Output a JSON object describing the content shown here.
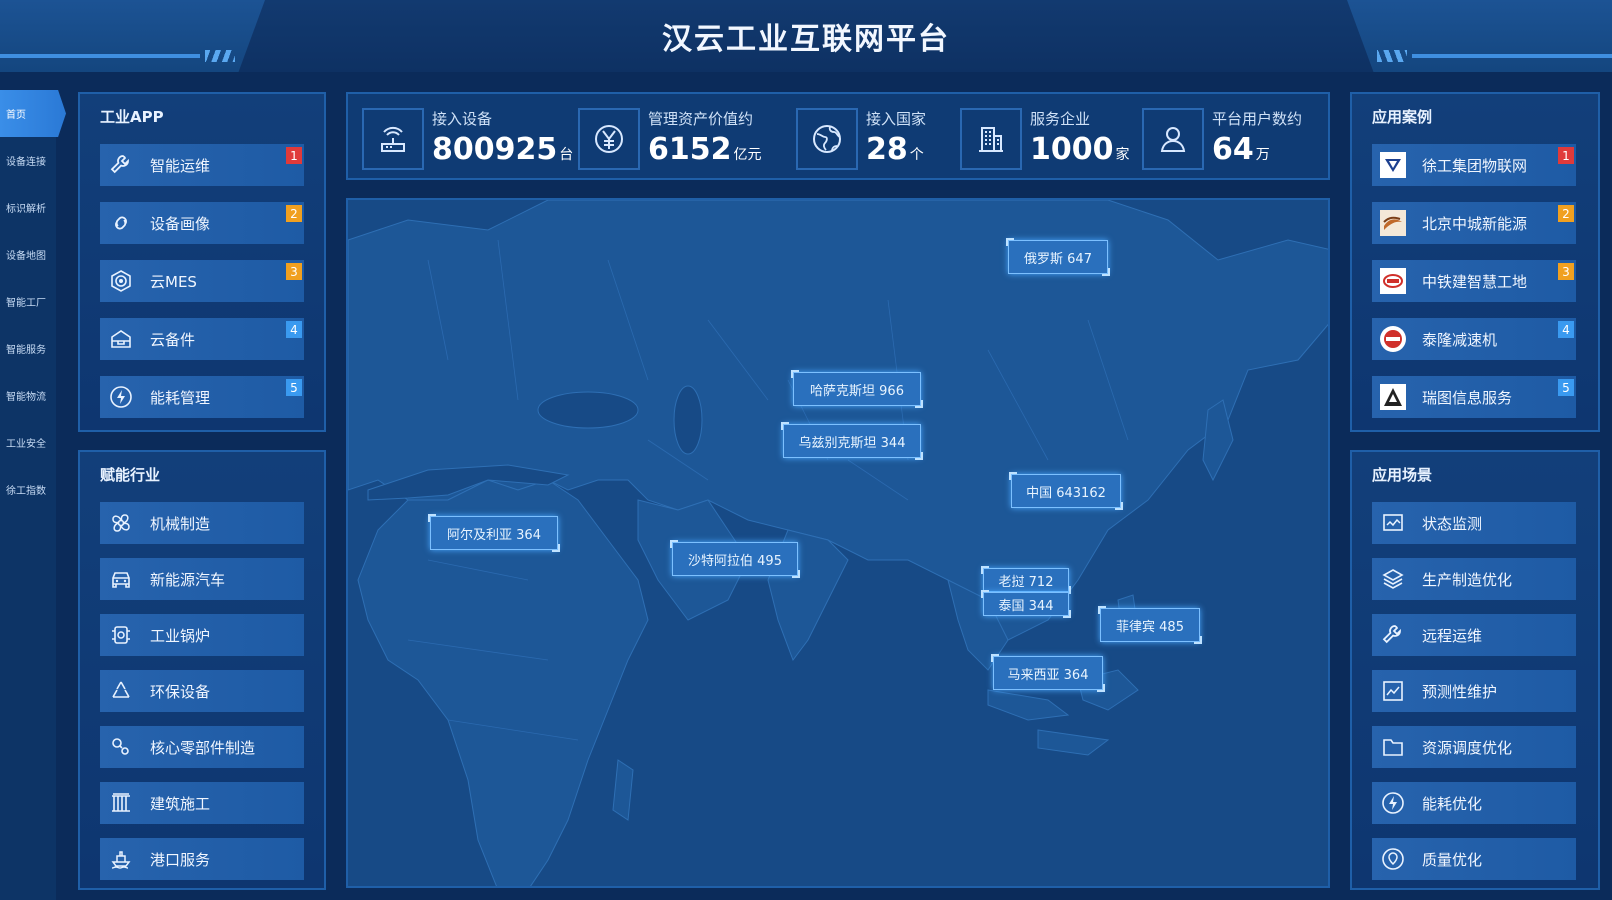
{
  "header": {
    "title": "汉云工业互联网平台"
  },
  "leftnav": {
    "items": [
      {
        "label": "首页",
        "active": true
      },
      {
        "label": "设备连接",
        "active": false
      },
      {
        "label": "标识解析",
        "active": false
      },
      {
        "label": "设备地图",
        "active": false
      },
      {
        "label": "智能工厂",
        "active": false
      },
      {
        "label": "智能服务",
        "active": false
      },
      {
        "label": "智能物流",
        "active": false
      },
      {
        "label": "工业安全",
        "active": false
      },
      {
        "label": "徐工指数",
        "active": false
      }
    ]
  },
  "industrial_app": {
    "title": "工业APP",
    "items": [
      {
        "label": "智能运维",
        "badge": "1",
        "badge_color": "#e03a3a",
        "icon": "wrench-icon"
      },
      {
        "label": "设备画像",
        "badge": "2",
        "badge_color": "#f0a020",
        "icon": "link-icon"
      },
      {
        "label": "云MES",
        "badge": "3",
        "badge_color": "#f0a020",
        "icon": "target-icon"
      },
      {
        "label": "云备件",
        "badge": "4",
        "badge_color": "#3a9af0",
        "icon": "box-icon"
      },
      {
        "label": "能耗管理",
        "badge": "5",
        "badge_color": "#3a9af0",
        "icon": "lightning-icon"
      }
    ]
  },
  "industries": {
    "title": "赋能行业",
    "items": [
      {
        "label": "机械制造",
        "icon": "fan-icon"
      },
      {
        "label": "新能源汽车",
        "icon": "car-icon"
      },
      {
        "label": "工业锅炉",
        "icon": "boiler-icon"
      },
      {
        "label": "环保设备",
        "icon": "recycle-icon"
      },
      {
        "label": "核心零部件制造",
        "icon": "gears-icon"
      },
      {
        "label": "建筑施工",
        "icon": "building-icon"
      },
      {
        "label": "港口服务",
        "icon": "ship-icon"
      }
    ]
  },
  "stats": [
    {
      "label": "接入设备",
      "value": "800925",
      "unit": "台",
      "icon": "router-icon"
    },
    {
      "label": "管理资产价值约",
      "value": "6152",
      "unit": "亿元",
      "icon": "yuan-icon"
    },
    {
      "label": "接入国家",
      "value": "28",
      "unit": "个",
      "icon": "globe-icon"
    },
    {
      "label": "服务企业",
      "value": "1000",
      "unit": "家",
      "icon": "office-icon"
    },
    {
      "label": "平台用户数约",
      "value": "64",
      "unit": "万",
      "icon": "user-icon"
    }
  ],
  "map_tags": [
    {
      "text": "俄罗斯 647"
    },
    {
      "text": "哈萨克斯坦 966"
    },
    {
      "text": "乌兹别克斯坦 344"
    },
    {
      "text": "中国 643162"
    },
    {
      "text": "阿尔及利亚 364"
    },
    {
      "text": "沙特阿拉伯 495"
    },
    {
      "text": "老挝 712"
    },
    {
      "text": "泰国 344"
    },
    {
      "text": "菲律宾 485"
    },
    {
      "text": "马来西亚 364"
    }
  ],
  "cases": {
    "title": "应用案例",
    "items": [
      {
        "label": "徐工集团物联网",
        "badge": "1",
        "badge_color": "#e03a3a",
        "logo": "xcmg-logo-icon"
      },
      {
        "label": "北京中城新能源",
        "badge": "2",
        "badge_color": "#f0a020",
        "logo": "energy-logo-icon"
      },
      {
        "label": "中铁建智慧工地",
        "badge": "3",
        "badge_color": "#f0a020",
        "logo": "crcc-logo-icon"
      },
      {
        "label": "泰隆减速机",
        "badge": "4",
        "badge_color": "#3a9af0",
        "logo": "tailong-logo-icon"
      },
      {
        "label": "瑞图信息服务",
        "badge": "5",
        "badge_color": "#3a9af0",
        "logo": "ruitu-logo-icon"
      }
    ]
  },
  "scenes": {
    "title": "应用场景",
    "items": [
      {
        "label": "状态监测",
        "icon": "monitor-icon"
      },
      {
        "label": "生产制造优化",
        "icon": "layers-icon"
      },
      {
        "label": "远程运维",
        "icon": "wrench-icon"
      },
      {
        "label": "预测性维护",
        "icon": "chart-icon"
      },
      {
        "label": "资源调度优化",
        "icon": "folder-icon"
      },
      {
        "label": "能耗优化",
        "icon": "lightning-icon"
      },
      {
        "label": "质量优化",
        "icon": "location-icon"
      }
    ]
  }
}
